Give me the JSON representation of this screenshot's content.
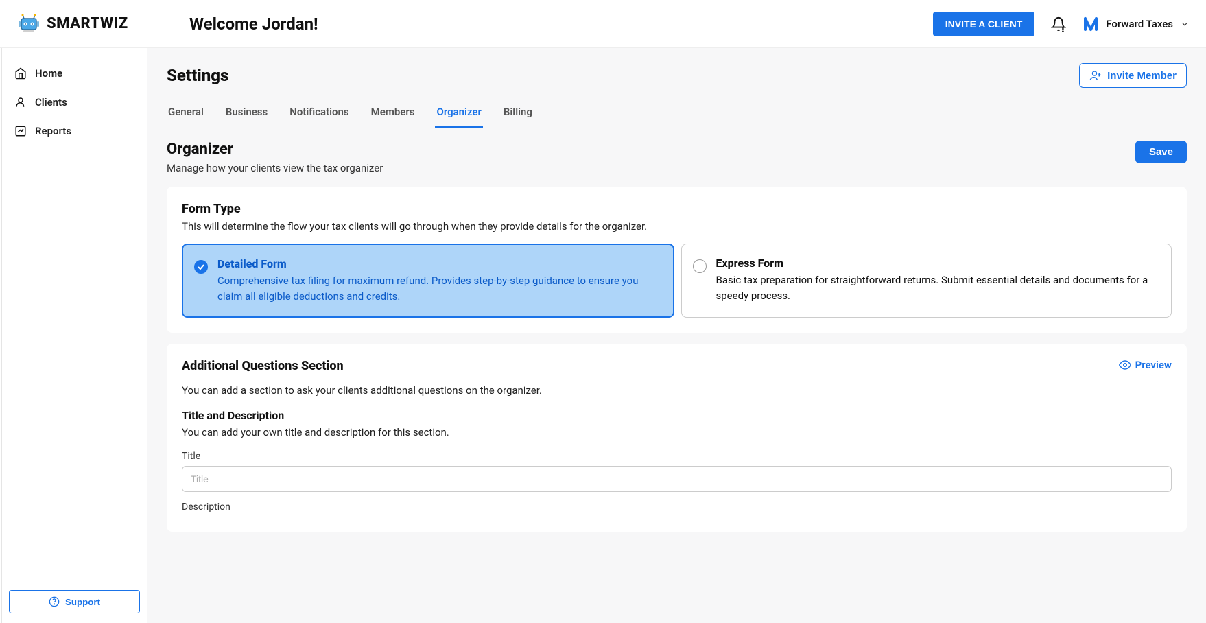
{
  "brand": "SMARTWIZ",
  "header": {
    "welcome": "Welcome Jordan!",
    "invite_client": "INVITE A CLIENT",
    "company_name": "Forward Taxes"
  },
  "sidebar": {
    "items": [
      {
        "label": "Home"
      },
      {
        "label": "Clients"
      },
      {
        "label": "Reports"
      }
    ],
    "support": "Support"
  },
  "page": {
    "title": "Settings",
    "invite_member": "Invite Member"
  },
  "tabs": [
    {
      "label": "General"
    },
    {
      "label": "Business"
    },
    {
      "label": "Notifications"
    },
    {
      "label": "Members"
    },
    {
      "label": "Organizer",
      "active": true
    },
    {
      "label": "Billing"
    }
  ],
  "organizer": {
    "title": "Organizer",
    "subtitle": "Manage how your clients view the tax organizer",
    "save": "Save",
    "form_type": {
      "title": "Form Type",
      "subtitle": "This will determine the flow your tax clients will go through when they provide details for the organizer.",
      "options": [
        {
          "title": "Detailed Form",
          "desc": "Comprehensive tax filing for maximum refund. Provides step-by-step guidance to ensure you claim all eligible deductions and credits.",
          "selected": true
        },
        {
          "title": "Express Form",
          "desc": "Basic tax preparation for straightforward returns. Submit essential details and documents for a speedy process.",
          "selected": false
        }
      ]
    },
    "additional": {
      "title": "Additional Questions Section",
      "subtitle": "You can add a section to ask your clients additional questions on the organizer.",
      "preview": "Preview",
      "td_heading": "Title and Description",
      "td_help": "You can add your own title and description for this section.",
      "title_label": "Title",
      "title_placeholder": "Title",
      "desc_label": "Description"
    }
  }
}
